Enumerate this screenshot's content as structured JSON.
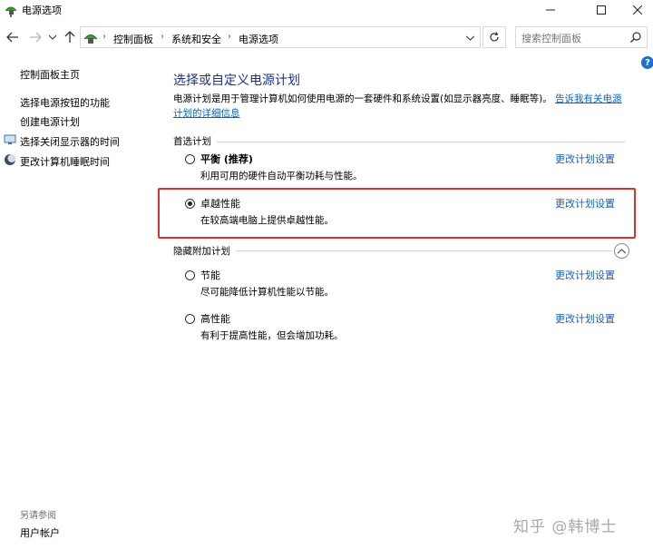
{
  "window": {
    "title": "电源选项",
    "icon": "power-options-icon"
  },
  "nav": {
    "breadcrumbs": [
      "控制面板",
      "系统和安全",
      "电源选项"
    ],
    "search_placeholder": "搜索控制面板"
  },
  "left": {
    "home": "控制面板主页",
    "links": [
      {
        "label": "选择电源按钮的功能",
        "icon": null
      },
      {
        "label": "创建电源计划",
        "icon": null
      },
      {
        "label": "选择关闭显示器的时间",
        "icon": "monitor-icon"
      },
      {
        "label": "更改计算机睡眠时间",
        "icon": "moon-icon"
      }
    ],
    "see_also": "另请参阅",
    "user_accounts": "用户帐户"
  },
  "main": {
    "title": "选择或自定义电源计划",
    "description_line1": "电源计划是用于管理计算机如何使用电源的一套硬件和系统设置(如显示器亮度、睡眠等)。",
    "description_link": "告诉我有关电源计划的详细信息",
    "preferred_label": "首选计划",
    "hidden_label": "隐藏附加计划",
    "plans": [
      {
        "name": "平衡 (推荐)",
        "desc": "利用可用的硬件自动平衡功耗与性能。",
        "link": "更改计划设置",
        "selected": false
      },
      {
        "name": "卓越性能",
        "desc": "在较高端电脑上提供卓越性能。",
        "link": "更改计划设置",
        "selected": true
      },
      {
        "name": "节能",
        "desc": "尽可能降低计算机性能以节能。",
        "link": "更改计划设置",
        "selected": false
      },
      {
        "name": "高性能",
        "desc": "有利于提高性能，但会增加功耗。",
        "link": "更改计划设置",
        "selected": false
      }
    ]
  },
  "watermark": "知乎 @韩博士",
  "colors": {
    "title_blue": "#1e3287",
    "link_blue": "#1a5fb4",
    "highlight_red": "#d9342b"
  }
}
